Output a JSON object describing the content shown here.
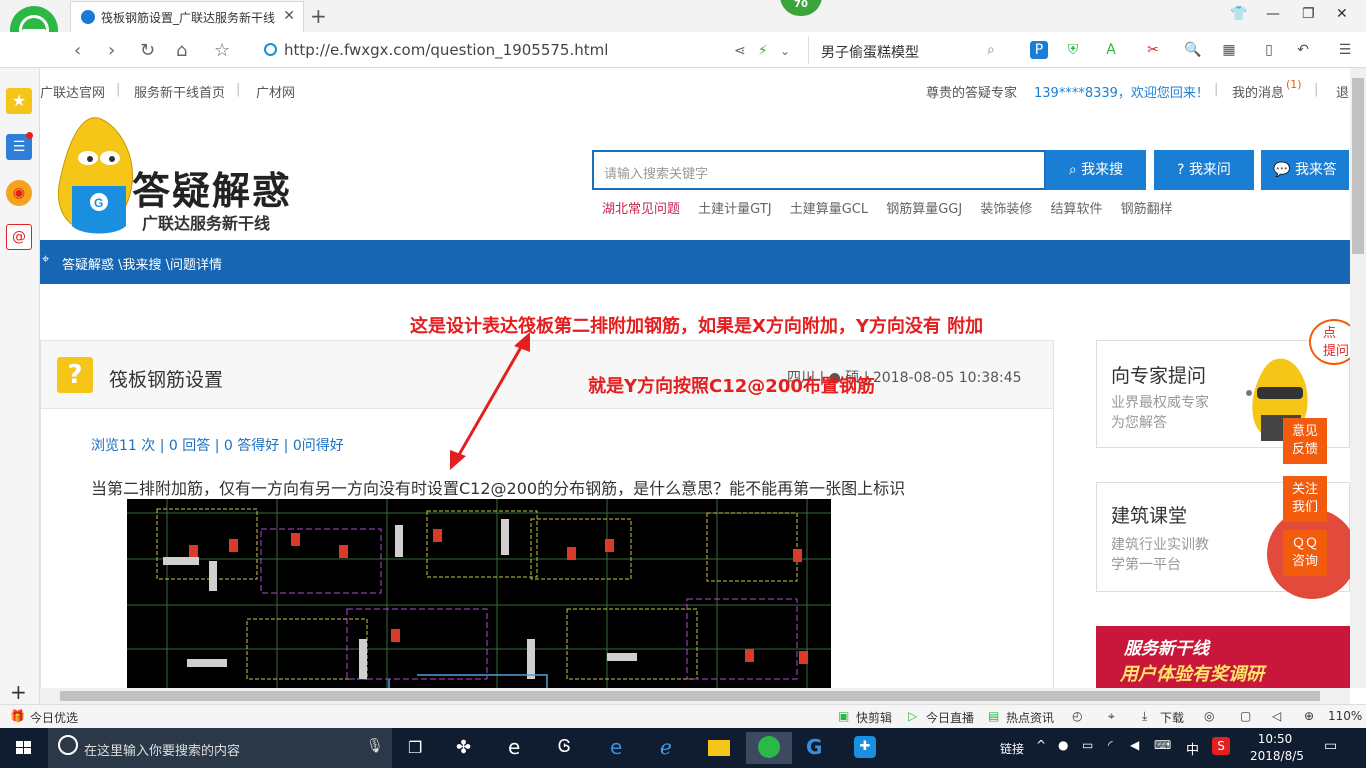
{
  "browser": {
    "tab_title": "筏板钢筋设置_广联达服务新干线",
    "badge": "70",
    "url": "http://e.fwxgx.com/question_1905575.html",
    "search_value": "男子偷蛋糕模型"
  },
  "topnav": {
    "links": [
      "广联达官网",
      "服务新干线首页",
      "广材网"
    ],
    "welcome_label": "尊贵的答疑专家",
    "user": "139****8339，欢迎您回来！",
    "messages": "我的消息",
    "message_count": "(1)",
    "logout": "退"
  },
  "header": {
    "logo_title": "答疑解惑",
    "logo_subtitle": "广联达服务新干线",
    "mascot_letter": "G",
    "search_placeholder": "请输入搜索关键字",
    "btn_search": "我来搜",
    "btn_ask": "我来问",
    "btn_answer": "我来答",
    "hot_links": [
      "湖北常见问题",
      "土建计量GTJ",
      "土建算量GCL",
      "钢筋算量GGJ",
      "装饰装修",
      "结算软件",
      "钢筋翻样"
    ]
  },
  "breadcrumb": "答疑解惑 \\我来搜 \\问题详情",
  "annotations": {
    "line1": "这是设计表达筏板第二排附加钢筋，如果是X方向附加，Y方向没有 附加",
    "line2": "就是Y方向按照C12@200布置钢筋"
  },
  "question": {
    "title": "筏板钢筋设置",
    "meta": "四川 | ● 硕 | 2018-08-05 10:38:45",
    "stats": "浏览11 次 | 0 回答 | 0 答得好 | 0问得好",
    "body": "当第二排附加筋，仅有一方向有另一方向没有时设置C12@200的分布钢筋，是什么意思？能不能再第一张图上标识"
  },
  "right": {
    "card1_title": "向专家提问",
    "card1_sub1": "业界最权威专家",
    "card1_sub2": "为您解答",
    "bubble": "点\n提问",
    "card2_title": "建筑课堂",
    "card2_sub1": "建筑行业实训教",
    "card2_sub2": "学第一平台",
    "float1": "意见\n反馈",
    "float2": "关注\n我们",
    "float3": "ＱＱ\n咨询",
    "banner1": "服务新干线",
    "banner2": "用户体验有奖调研"
  },
  "statusbar": {
    "left": "今日优选",
    "items": [
      "快剪辑",
      "今日直播",
      "热点资讯",
      "下载"
    ],
    "zoom": "110%"
  },
  "taskbar": {
    "search_placeholder": "在这里输入你要搜索的内容",
    "tray_link": "链接",
    "ime": "中",
    "time": "10:50",
    "date": "2018/8/5"
  },
  "colors": {
    "brand_blue": "#1666b3",
    "button_blue": "#1a7fd4",
    "annotation_red": "#e41f1f",
    "float_orange": "#f25c0c"
  }
}
